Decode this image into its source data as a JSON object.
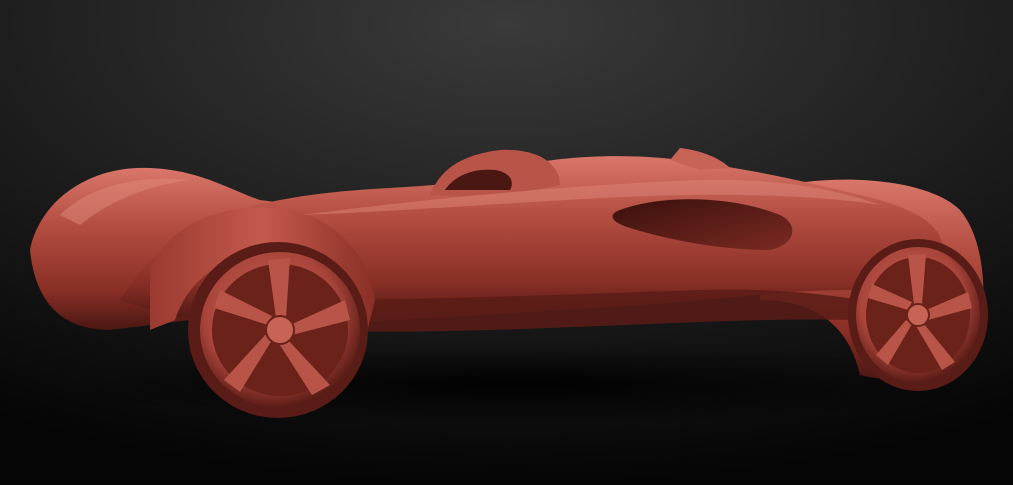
{
  "viewport": {
    "background_top": "#3a3a3a",
    "background_bottom": "#050505"
  },
  "model": {
    "material_color": "#a8443a",
    "highlight_color": "#d9776a",
    "shadow_color": "#4a1712",
    "icons": [
      "sculpted-car-model-icon",
      "front-wheel-icon",
      "rear-wheel-icon"
    ]
  }
}
